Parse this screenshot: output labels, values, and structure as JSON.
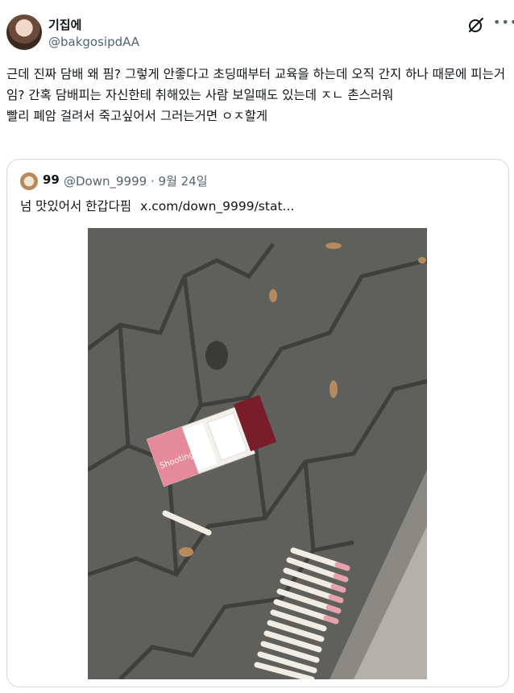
{
  "author": {
    "name": "기집에",
    "handle": "@bakgosipdAA"
  },
  "icons": {
    "grok": "grok-slash-icon",
    "more": "more-horizontal-icon"
  },
  "tweet": {
    "text": "근데 진짜 담배 왜 핌? 그렇게 안좋다고 초딩때부터 교육을 하는데 오직 간지 하나 때문에 피는거임? 간혹 담배피는 자신한테 취해있는 사람 보일때도 있는데 ㅈㄴ 촌스러워\n빨리 폐암 걸려서 죽고싶어서 그러는거면 ㅇㅈ할게"
  },
  "quote": {
    "name": "99",
    "handle": "@Down_9999",
    "separator": "·",
    "date": "9월 24일",
    "text": "넘 맛있어서 한갑다핌",
    "link": "x.com/down_9999/stat..."
  },
  "photo": {
    "pack_brand": "Shooting"
  },
  "colors": {
    "text": "#0f1419",
    "secondary": "#536471",
    "border": "#cfd9de",
    "pavement": "#5f5f5c"
  }
}
